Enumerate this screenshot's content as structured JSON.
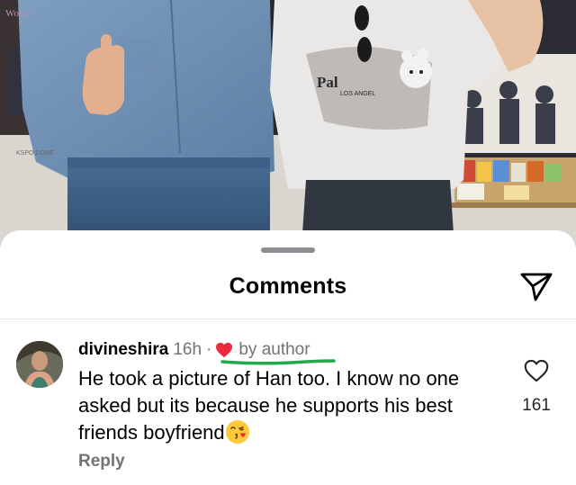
{
  "sheet": {
    "title": "Comments"
  },
  "comment": {
    "username": "divineshira",
    "time": "16h",
    "separator": "·",
    "author_tag": "by author",
    "text": "He took a picture of Han too. I know no one asked but its because he supports his best friends boyfriend",
    "emoji": "face-blowing-a-kiss",
    "like_count": "161",
    "reply_label": "Reply"
  },
  "photo_text": {
    "shirt_print": "Palm Angels",
    "shirt_sub": "LOS ANGELES",
    "poster_text": "KSPO DOME",
    "corner_text": "World"
  },
  "colors": {
    "heart_red": "#ED2B3D",
    "underline_green": "#22A94A",
    "secondary_text": "#737373"
  },
  "icons": {
    "send": "paper-plane-icon",
    "like": "heart-outline-icon",
    "author_heart": "heart-filled-icon"
  }
}
